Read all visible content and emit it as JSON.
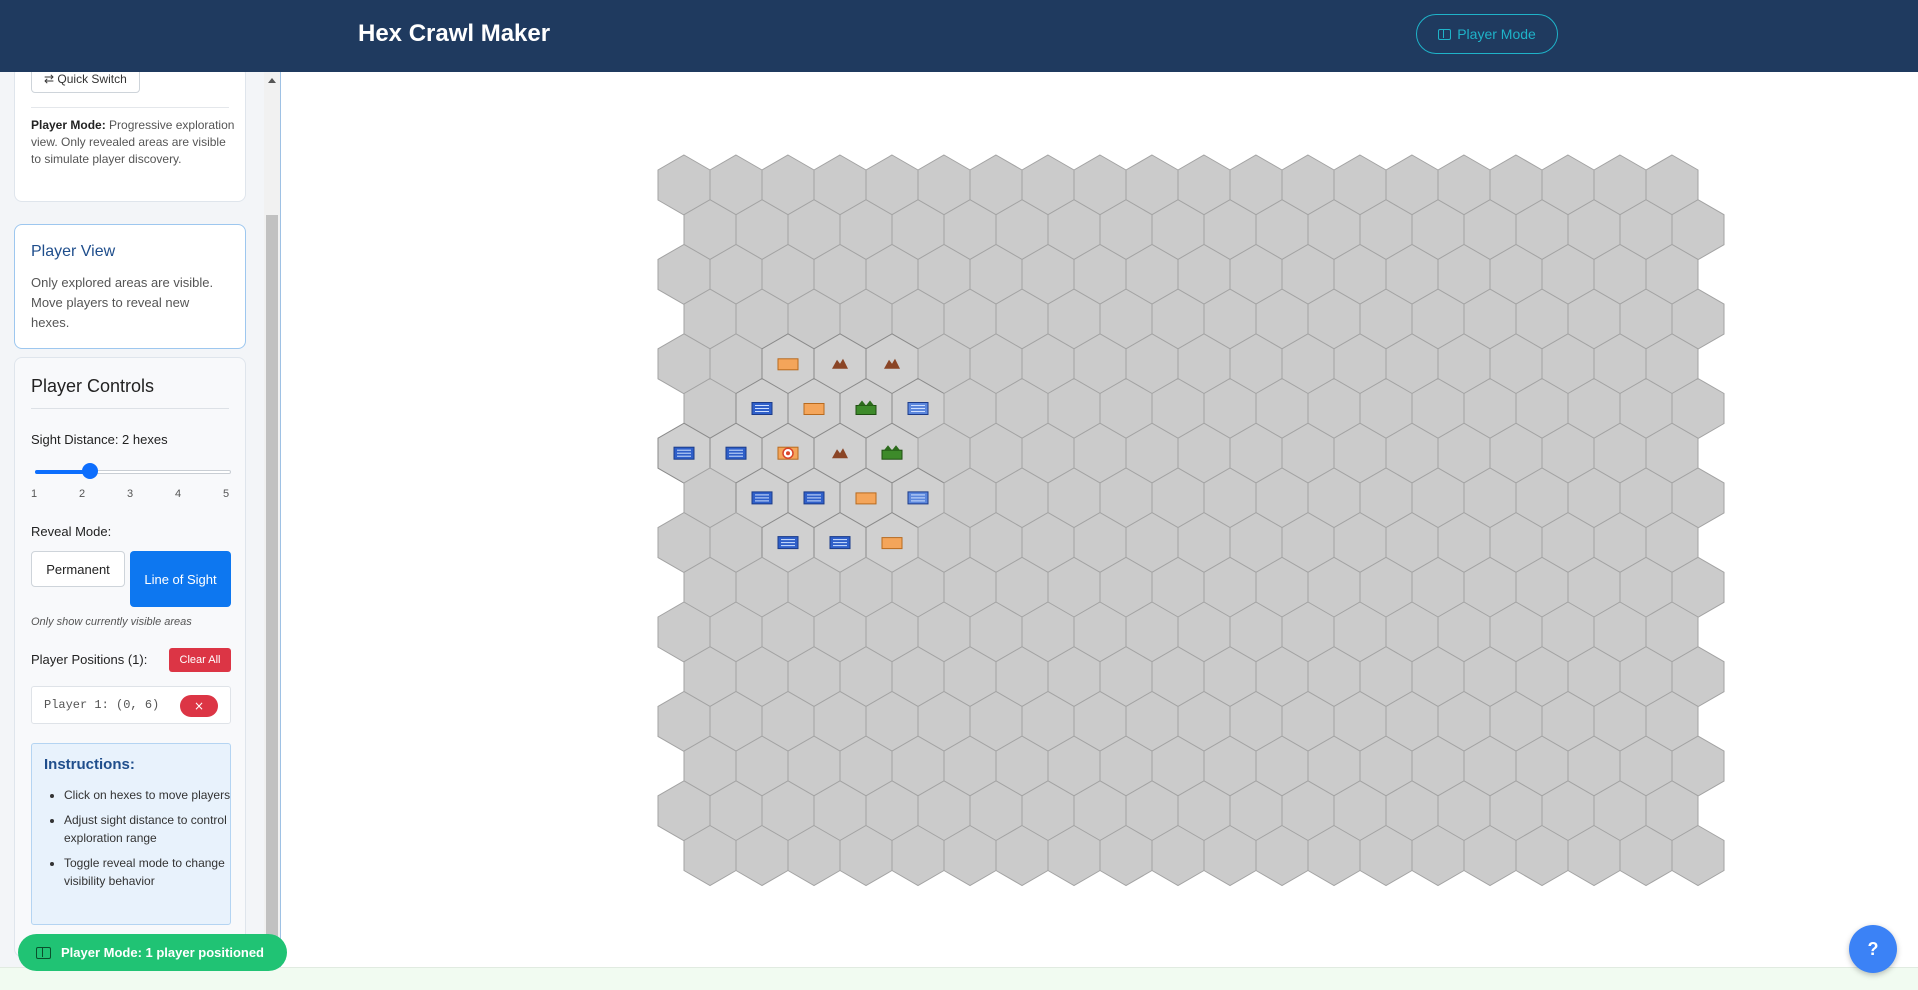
{
  "header": {
    "app_title": "Hex Crawl Maker",
    "mode_button_label": "Player Mode",
    "background": "#1f3a5f",
    "accent": "#1fb3c9"
  },
  "sidebar": {
    "mode_card": {
      "quick_switch_label": "⇄ Quick Switch",
      "mode_label": "Player Mode:",
      "mode_description": "Progressive exploration view. Only revealed areas are visible to simulate player discovery."
    },
    "view_card": {
      "title": "Player View",
      "description": "Only explored areas are visible. Move players to reveal new hexes."
    },
    "controls": {
      "title": "Player Controls",
      "sight_label": "Sight Distance: 2 hexes",
      "sight_value": 2,
      "sight_min": 1,
      "sight_max": 5,
      "tick_labels": [
        "1",
        "2",
        "3",
        "4",
        "5"
      ],
      "reveal_label": "Reveal Mode:",
      "reveal_options": [
        "Permanent",
        "Line of Sight"
      ],
      "reveal_selected": "Line of Sight",
      "reveal_hint": "Only show currently visible areas",
      "positions_label": "Player Positions (1):",
      "clear_all_label": "Clear All",
      "players": [
        {
          "label": "Player 1: (0, 6)",
          "remove_label": "×"
        }
      ],
      "instructions": {
        "title": "Instructions:",
        "items": [
          "Click on hexes to move players",
          "Adjust sight distance to control exploration range",
          "Toggle reveal mode to change visibility behavior"
        ]
      }
    }
  },
  "map": {
    "columns": 20,
    "rows": 16,
    "unrevealed_color": "#cbcbcb",
    "revealed_color": "#d0d0d0",
    "terrain_colors": {
      "water": "#2f5fc9",
      "plains": "#f4a55a",
      "mountain": "#8a4526",
      "forest": "#3d8a2a",
      "player": "#e7743b"
    },
    "revealed_hexes": [
      {
        "col": 2,
        "row": 4,
        "terrain": "plains"
      },
      {
        "col": 3,
        "row": 4,
        "terrain": "mountain"
      },
      {
        "col": 4,
        "row": 4,
        "terrain": "mountain"
      },
      {
        "col": 1,
        "row": 5,
        "terrain": "water"
      },
      {
        "col": 2,
        "row": 5,
        "terrain": "plains"
      },
      {
        "col": 3,
        "row": 5,
        "terrain": "forest"
      },
      {
        "col": 4,
        "row": 5,
        "terrain": "water-light"
      },
      {
        "col": 0,
        "row": 6,
        "terrain": "water"
      },
      {
        "col": 1,
        "row": 6,
        "terrain": "water"
      },
      {
        "col": 2,
        "row": 6,
        "terrain": "player"
      },
      {
        "col": 3,
        "row": 6,
        "terrain": "mountain"
      },
      {
        "col": 4,
        "row": 6,
        "terrain": "forest"
      },
      {
        "col": 1,
        "row": 7,
        "terrain": "water"
      },
      {
        "col": 2,
        "row": 7,
        "terrain": "water"
      },
      {
        "col": 3,
        "row": 7,
        "terrain": "plains"
      },
      {
        "col": 4,
        "row": 7,
        "terrain": "water-light"
      },
      {
        "col": 2,
        "row": 8,
        "terrain": "water"
      },
      {
        "col": 3,
        "row": 8,
        "terrain": "water"
      },
      {
        "col": 4,
        "row": 8,
        "terrain": "plains"
      }
    ]
  },
  "status_toast": "Player Mode: 1 player positioned",
  "help_button_label": "?"
}
